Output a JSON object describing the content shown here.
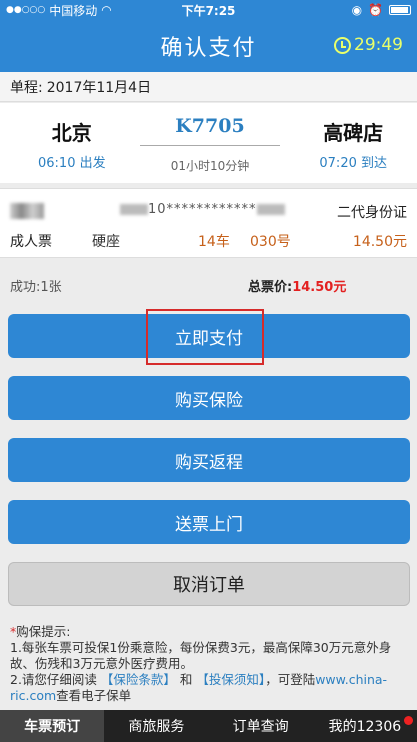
{
  "status_bar": {
    "carrier": "中国移动",
    "time": "下午7:25"
  },
  "header": {
    "title": "确认支付",
    "countdown": "29:49"
  },
  "trip": {
    "date_label": "单程:",
    "date": "2017年11月4日"
  },
  "route": {
    "from_city": "北京",
    "from_time": "06:10 出发",
    "train_no": "K7705",
    "duration": "01小时10分钟",
    "to_city": "高碑店",
    "to_time": "07:20 到达"
  },
  "passenger": {
    "name": "",
    "id_prefix": "10",
    "id_mask": "************",
    "id_type": "二代身份证",
    "ticket_type": "成人票",
    "seat_class": "硬座",
    "car": "14车",
    "seat_no": "030号",
    "price": "14.50元"
  },
  "summary": {
    "count": "成功:1张",
    "total_label": "总票价:",
    "total_value": "14.50元"
  },
  "buttons": {
    "pay": "立即支付",
    "insurance": "购买保险",
    "return": "购买返程",
    "delivery": "送票上门",
    "cancel": "取消订单"
  },
  "tips": {
    "star": "*",
    "title": "购保提示:",
    "line1": "1.每张车票可投保1份乘意险，每份保费3元，最高保障30万元意外身故、伤残和3万元意外医疗费用。",
    "line2_pre": "2.请您仔细阅读",
    "link1": "【保险条款】",
    "and": "和",
    "link2": "【投保须知】",
    "line2_post": "，可登陆",
    "url": "www.china-ric.com",
    "line2_end": "查看电子保单"
  },
  "tabs": [
    "车票预订",
    "商旅服务",
    "订单查询",
    "我的12306"
  ],
  "colors": {
    "primary": "#2e87d4",
    "accent_price": "#c6601a",
    "total_red": "#e32020",
    "countdown": "#e9ff6a"
  }
}
